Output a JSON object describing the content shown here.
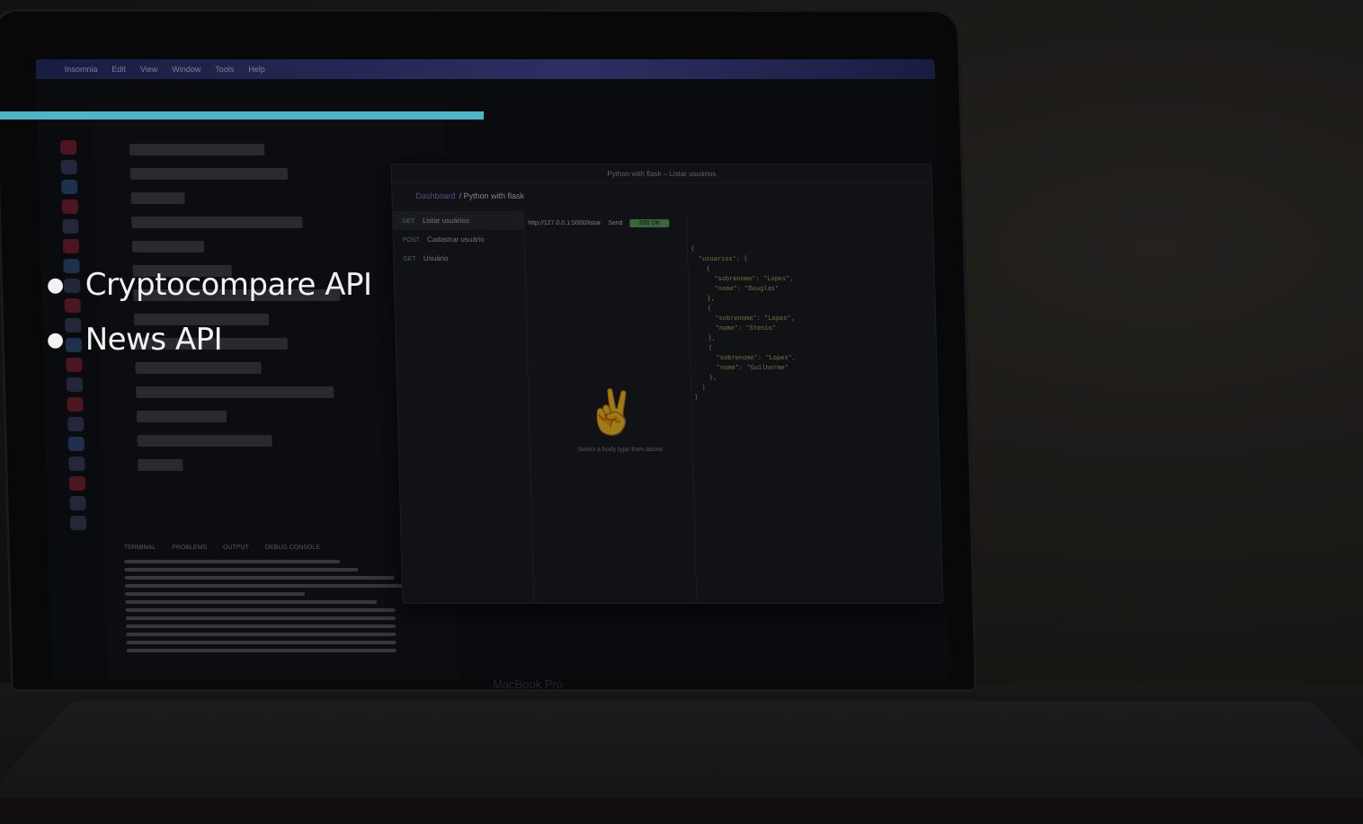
{
  "slide": {
    "accent_color": "#4bb6c5",
    "bullets": [
      {
        "text": "Cryptocompare API"
      },
      {
        "text": "News API"
      }
    ]
  },
  "background_photo": {
    "laptop_brand": "MacBook Pro",
    "menubar": [
      "Insomnia",
      "Edit",
      "View",
      "Window",
      "Tools",
      "Help"
    ],
    "insomnia": {
      "title": "Python with flask – Listar usuários",
      "crumb_prefix": "Dashboard",
      "crumb": "/ Python with flask",
      "requests": [
        {
          "method": "GET",
          "label": "Listar usuários"
        },
        {
          "method": "POST",
          "label": "Cadastrar usuário"
        },
        {
          "method": "GET",
          "label": "Usuário"
        }
      ],
      "url": "http://127.0.0.1:5000/listar",
      "send": "Send",
      "status": "200 OK",
      "empty_hint": "Select a body type from above"
    },
    "terminal_tabs": [
      "TERMINAL",
      "PROBLEMS",
      "OUTPUT",
      "DEBUG CONSOLE"
    ]
  }
}
